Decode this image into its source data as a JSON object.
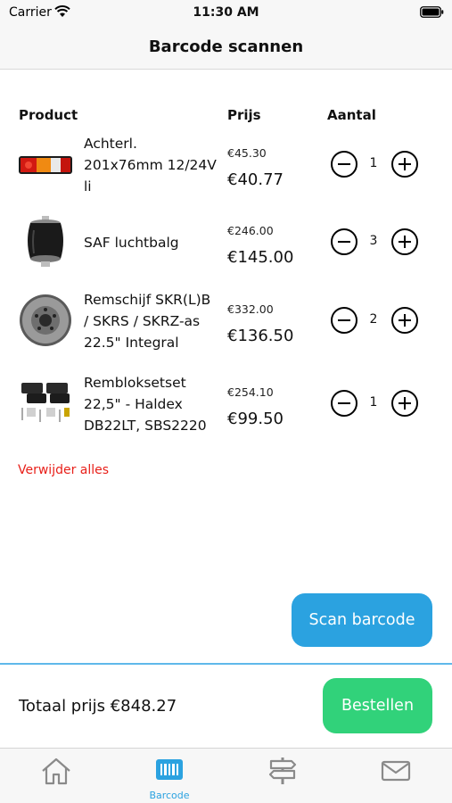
{
  "status_bar": {
    "carrier": "Carrier",
    "time": "11:30 AM"
  },
  "nav": {
    "title": "Barcode scannen"
  },
  "table": {
    "headers": {
      "product": "Product",
      "price": "Prijs",
      "quantity": "Aantal"
    },
    "rows": [
      {
        "name": "Achterl. 201x76mm 12/24V li",
        "old_price": "€45.30",
        "price": "€40.77",
        "qty": "1",
        "image": "tail-light-image"
      },
      {
        "name": "SAF luchtbalg",
        "old_price": "€246.00",
        "price": "€145.00",
        "qty": "3",
        "image": "air-spring-image"
      },
      {
        "name": "Remschijf SKR(L)B / SKRS / SKRZ-as 22.5\" Integral",
        "old_price": "€332.00",
        "price": "€136.50",
        "qty": "2",
        "image": "brake-disc-image"
      },
      {
        "name": "Rembloksetset 22,5\" - Haldex DB22LT, SBS2220",
        "old_price": "€254.10",
        "price": "€99.50",
        "qty": "1",
        "image": "brake-pad-set-image"
      }
    ]
  },
  "remove_all": "Verwijder alles",
  "scan_button": "Scan barcode",
  "total": "Totaal prijs €848.27",
  "order_button": "Bestellen",
  "tabs": [
    {
      "icon": "home-icon",
      "label": ""
    },
    {
      "icon": "barcode-icon",
      "label": "Barcode",
      "active": true
    },
    {
      "icon": "signpost-icon",
      "label": ""
    },
    {
      "icon": "mail-icon",
      "label": ""
    }
  ],
  "colors": {
    "accent": "#2ba2e0",
    "order": "#31d27a",
    "danger": "#e8201a",
    "tab_inactive": "#8a8a8a"
  }
}
